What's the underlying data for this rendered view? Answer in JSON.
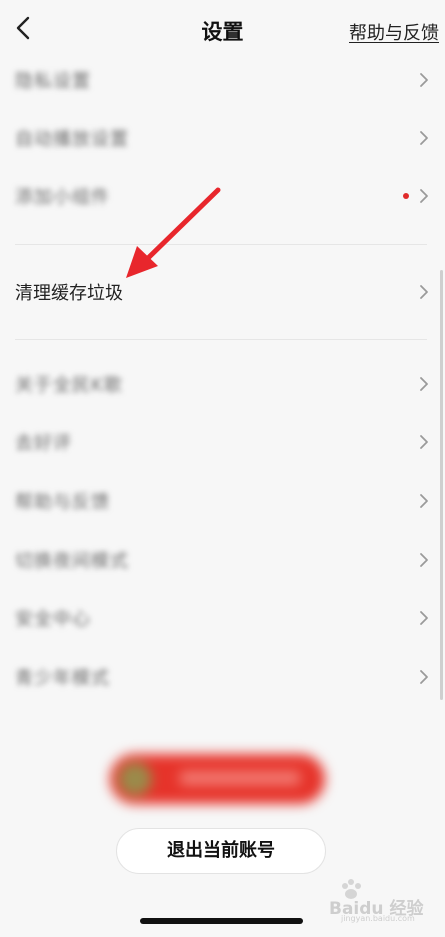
{
  "nav": {
    "title": "设置",
    "help_link": "帮助与反馈"
  },
  "settings_groups": [
    {
      "items": [
        {
          "label": "隐私设置",
          "blurred": true
        },
        {
          "label": "自动播放设置",
          "blurred": true
        },
        {
          "label": "添加小组件",
          "blurred": true,
          "has_red_dot": true
        }
      ]
    },
    {
      "items": [
        {
          "label": "清理缓存垃圾",
          "blurred": false
        }
      ]
    },
    {
      "items": [
        {
          "label": "关于全民K歌",
          "blurred": true
        },
        {
          "label": "去好评",
          "blurred": true
        },
        {
          "label": "帮助与反馈",
          "blurred": true
        },
        {
          "label": "切换夜间模式",
          "blurred": true
        },
        {
          "label": "安全中心",
          "blurred": true
        },
        {
          "label": "青少年模式",
          "blurred": true
        }
      ]
    }
  ],
  "logout_button": "退出当前账号",
  "watermark": {
    "brand": "Baidu 经验",
    "sub": "jingyan.baidu.com"
  },
  "colors": {
    "background": "#f7f7f7",
    "accent_red": "#e02b2b",
    "promo_red": "#e6332a",
    "annotation_arrow": "#e8262c"
  },
  "icons": {
    "back": "chevron-left-icon",
    "row_arrow": "chevron-right-icon",
    "notification": "red-dot-badge"
  }
}
